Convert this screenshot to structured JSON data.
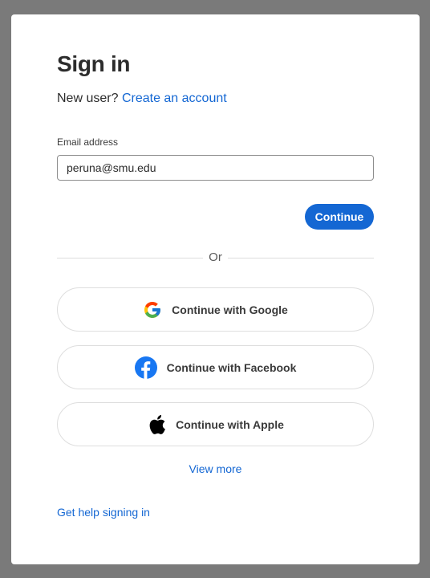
{
  "signin": {
    "title": "Sign in",
    "new_user_prefix": "New user?",
    "create_account_link": "Create an account",
    "email_label": "Email address",
    "email_value": "peruna@smu.edu",
    "continue_button": "Continue",
    "divider_text": "Or",
    "social": [
      {
        "label": "Continue with Google",
        "icon": "google-icon"
      },
      {
        "label": "Continue with Facebook",
        "icon": "facebook-icon"
      },
      {
        "label": "Continue with Apple",
        "icon": "apple-icon"
      }
    ],
    "view_more_link": "View more",
    "help_link": "Get help signing in"
  },
  "colors": {
    "accent": "#1467d3",
    "facebook": "#1877f2",
    "backdrop": "#7a7a7a"
  }
}
